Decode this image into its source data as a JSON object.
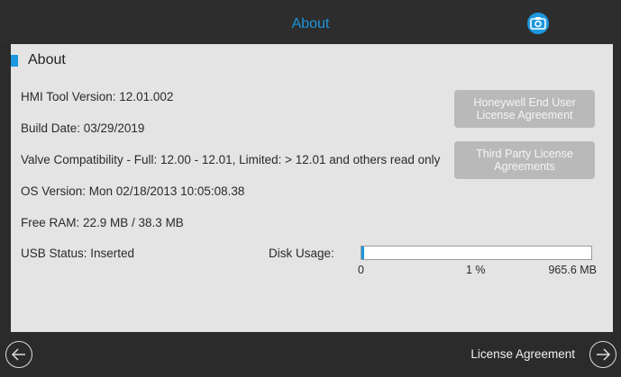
{
  "header": {
    "title": "About"
  },
  "section": {
    "title": "About"
  },
  "info": {
    "hmi_version": "HMI Tool Version: 12.01.002",
    "build_date": "Build Date: 03/29/2019",
    "valve_compat": "Valve Compatibility - Full: 12.00 - 12.01, Limited: > 12.01 and others read only",
    "os_version": "OS Version: Mon 02/18/2013 10:05:08.38",
    "free_ram": "Free RAM: 22.9 MB / 38.3 MB",
    "usb_status": "USB Status: Inserted"
  },
  "buttons": {
    "honeywell_license": "Honeywell End User License Agreement",
    "third_party_license": "Third Party License Agreements"
  },
  "disk": {
    "label": "Disk Usage:",
    "min": "0",
    "percent_text": "1 %",
    "max": "965.6 MB",
    "fraction": 0.01
  },
  "footer": {
    "license_label": "License Agreement"
  },
  "icons": {
    "camera": "camera-icon",
    "back": "arrow-left-icon",
    "forward": "arrow-right-icon"
  },
  "colors": {
    "accent": "#1a97e0",
    "button": "#b9b9b9",
    "panel": "#e4e4e4",
    "bar_bg": "#2d2d2d"
  }
}
